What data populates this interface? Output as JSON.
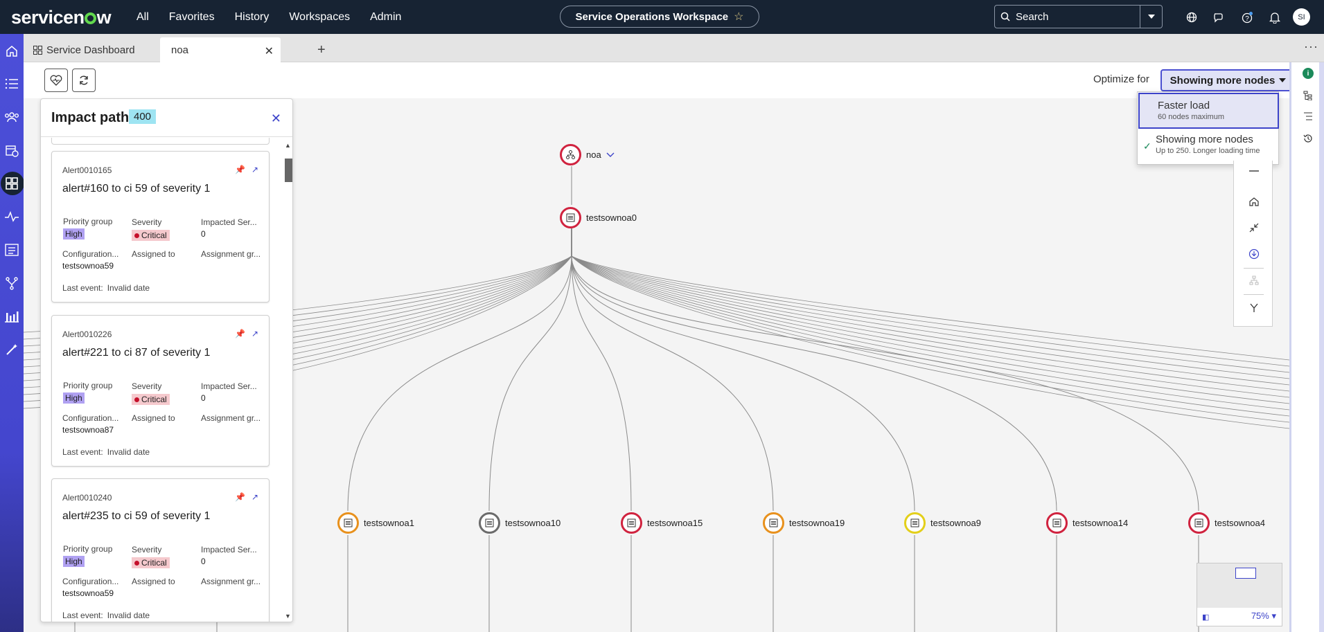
{
  "app": {
    "logo": "servicenow",
    "nav": [
      "All",
      "Favorites",
      "History",
      "Workspaces",
      "Admin"
    ],
    "workspace_pill": "Service Operations Workspace",
    "search_placeholder": "Search",
    "avatar_initials": "SI"
  },
  "tabs": [
    {
      "label": "Service Dashboard"
    },
    {
      "label": "noa"
    }
  ],
  "toolbar": {
    "optimize_label": "Optimize for",
    "optimize_value": "Showing more nodes"
  },
  "dropdown": {
    "options": [
      {
        "title": "Faster load",
        "subtitle": "60 nodes maximum"
      },
      {
        "title": "Showing more nodes",
        "subtitle": "Up to 250. Longer loading time"
      }
    ]
  },
  "impact_panel": {
    "title": "Impact path",
    "count": "400",
    "field_labels": {
      "priority": "Priority group",
      "severity": "Severity",
      "impacted": "Impacted Ser...",
      "config": "Configuration...",
      "assigned": "Assigned to",
      "group": "Assignment gr...",
      "last_event": "Last event:"
    },
    "cards": [
      {
        "number": "Alert0010165",
        "title": "alert#160 to ci 59 of severity 1",
        "priority": "High",
        "severity": "Critical",
        "impacted": "0",
        "ci": "testsownoa59",
        "last_event": "Invalid date"
      },
      {
        "number": "Alert0010226",
        "title": "alert#221 to ci 87 of severity 1",
        "priority": "High",
        "severity": "Critical",
        "impacted": "0",
        "ci": "testsownoa87",
        "last_event": "Invalid date"
      },
      {
        "number": "Alert0010240",
        "title": "alert#235 to ci 59 of severity 1",
        "priority": "High",
        "severity": "Critical",
        "impacted": "0",
        "ci": "testsownoa59",
        "last_event": "Invalid date"
      }
    ]
  },
  "graph": {
    "root": "noa",
    "level1": "testsownoa0",
    "children": [
      {
        "label": "testsownoa1",
        "status_color": "#e8911d"
      },
      {
        "label": "testsownoa10",
        "status_color": "#6b6b6b"
      },
      {
        "label": "testsownoa15",
        "status_color": "#d0233f"
      },
      {
        "label": "testsownoa19",
        "status_color": "#e8911d"
      },
      {
        "label": "testsownoa9",
        "status_color": "#e3cf1a"
      },
      {
        "label": "testsownoa14",
        "status_color": "#d0233f"
      },
      {
        "label": "testsownoa4",
        "status_color": "#d0233f"
      }
    ],
    "zoom": "75%"
  },
  "colors": {
    "topbar": "#172333",
    "rail": "#4c4fd8",
    "accent": "#3c43c9",
    "critical": "#d0233f"
  }
}
